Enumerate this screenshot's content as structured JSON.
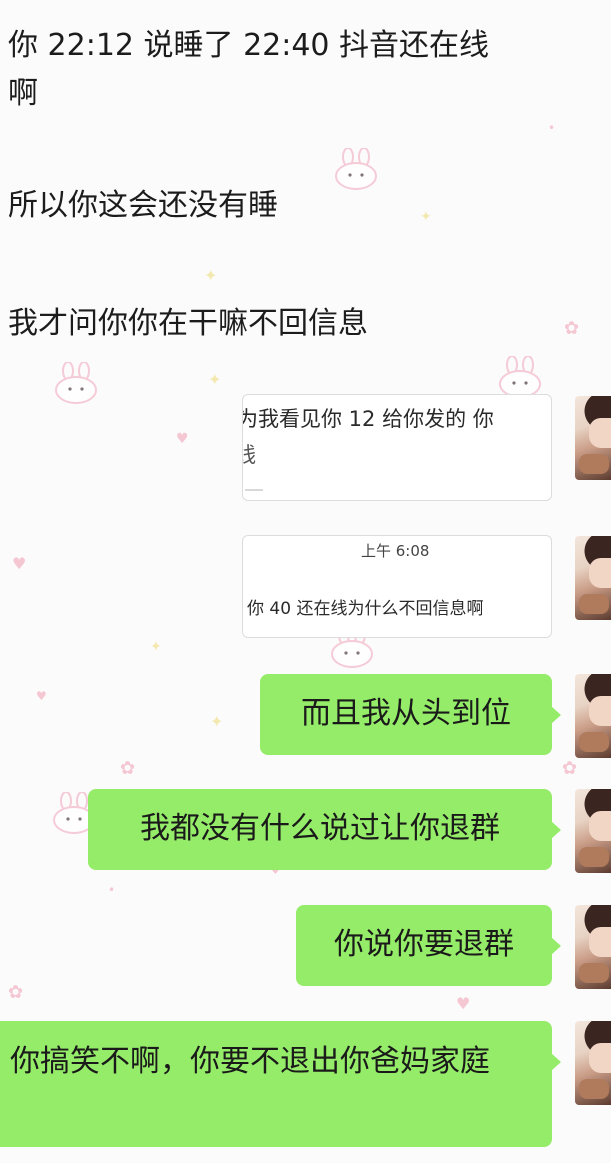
{
  "chat": {
    "quoted_lines": [
      "你 22:12 说睡了 22:40 抖音还在线\n啊",
      "所以你这会还没有睡",
      "我才问你你在干嘛不回信息"
    ],
    "forwarded_cards": [
      {
        "text": "为我看见你 12 给你发的 你",
        "continuation": "线"
      },
      {
        "timestamp": "上午 6:08",
        "text": "你 40 还在线为什么不回信息啊"
      }
    ],
    "sent_messages": [
      "而且我从头到位",
      "我都没有什么说过让你退群",
      "你说你要退群",
      "你搞笑不啊，你要不退出你爸妈家庭"
    ]
  },
  "colors": {
    "sent_bubble": "#95ec69",
    "wallpaper": "#fcfbfc",
    "wallpaper_deco": "#f4c7d2"
  },
  "icons": {
    "avatar": "user-avatar-photo",
    "wallpaper_decoration": "pink-bunny-and-heart-pattern"
  }
}
